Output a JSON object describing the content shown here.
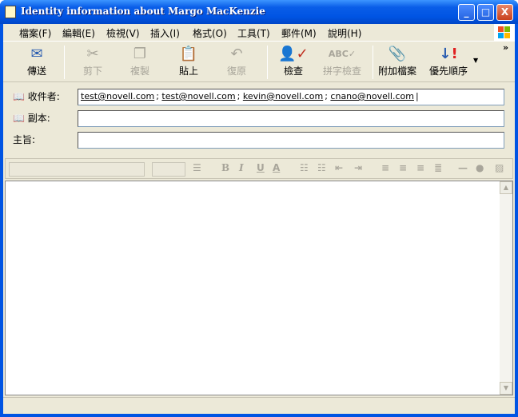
{
  "window": {
    "title": "Identity information about Margo MacKenzie",
    "minimize": "_",
    "maximize": "□",
    "close": "X"
  },
  "menu": [
    "檔案(F)",
    "編輯(E)",
    "檢視(V)",
    "插入(I)",
    "格式(O)",
    "工具(T)",
    "郵件(M)",
    "說明(H)"
  ],
  "toolbar": {
    "send": "傳送",
    "cut": "剪下",
    "copy": "複製",
    "paste": "貼上",
    "undo": "復原",
    "check": "檢查",
    "spelling": "拼字檢查",
    "attach": "附加檔案",
    "priority": "優先順序",
    "more": "»"
  },
  "fields": {
    "to_label": "收件者:",
    "to_value": [
      "test@novell.com",
      "test@novell.com",
      "kevin@novell.com",
      "cnano@novell.com"
    ],
    "cc_label": "副本:",
    "cc_value": "",
    "subject_label": "主旨:",
    "subject_value": ""
  },
  "body": {
    "text": ""
  }
}
